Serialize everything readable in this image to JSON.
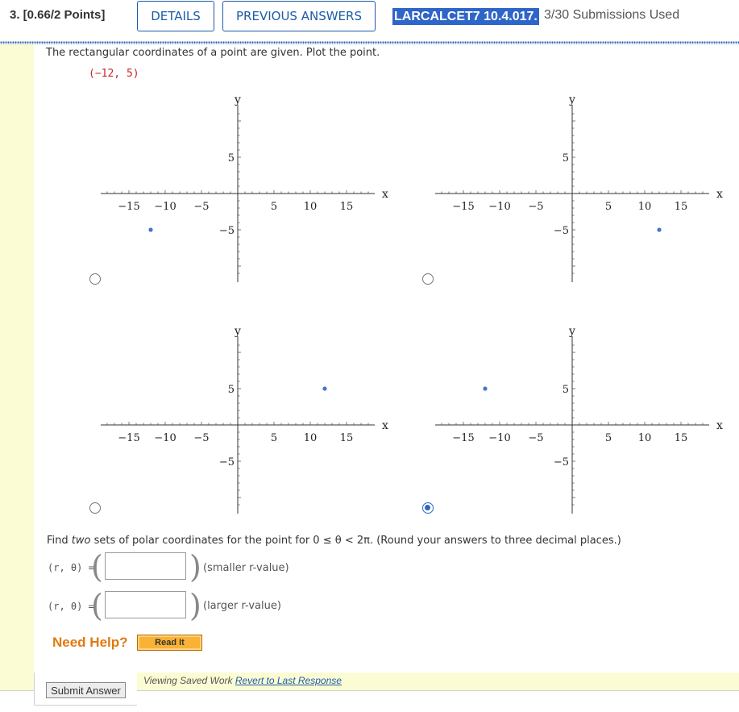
{
  "header": {
    "question_label": "3.  [0.66/2 Points]",
    "details_label": "DETAILS",
    "previous_label": "PREVIOUS ANSWERS",
    "problem_id": "LARCALCET7 10.4.017.",
    "submissions": "3/30 Submissions Used"
  },
  "question": {
    "prompt": "The rectangular coordinates of a point are given. Plot the point.",
    "point": "(−12, 5)"
  },
  "graphs": {
    "y_label": "y",
    "x_label": "x",
    "x_ticks": [
      "−15",
      "−10",
      "−5",
      "5",
      "10",
      "15"
    ],
    "y_ticks": [
      "5",
      "−5"
    ],
    "options": [
      {
        "name": "option-a",
        "point": [
          -12,
          -5
        ],
        "selected": false
      },
      {
        "name": "option-b",
        "point": [
          12,
          -5
        ],
        "selected": false
      },
      {
        "name": "option-c",
        "point": [
          12,
          5
        ],
        "selected": false
      },
      {
        "name": "option-d",
        "point": [
          -12,
          5
        ],
        "selected": true
      }
    ],
    "point_color": "#4a74c9"
  },
  "part2": {
    "find_prefix": "Find ",
    "find_italic": "two",
    "find_suffix": " sets of polar coordinates for the point for 0 ≤ θ < 2π. (Round your answers to three decimal places.)",
    "row_label": "(r, θ)  =",
    "smaller_label": "(smaller r-value)",
    "larger_label": "(larger r-value)",
    "answer1": "",
    "answer2": ""
  },
  "help": {
    "need_help": "Need Help?",
    "read_it": "Read It"
  },
  "footer": {
    "submit_label": "Submit Answer",
    "viewing_text": "Viewing Saved Work ",
    "revert_link": "Revert to Last Response"
  },
  "colors": {
    "accent": "#1d5ca8",
    "tag_bg": "#2e65c8",
    "yellow": "#fcfcd4",
    "coord_red": "#c62828",
    "help_orange": "#e07a12"
  }
}
